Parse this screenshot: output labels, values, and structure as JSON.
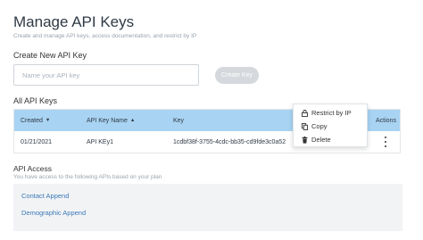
{
  "page": {
    "title": "Manage API Keys",
    "subtitle": "Create and manage API keys, access documentation, and restrict by IP"
  },
  "create": {
    "label": "Create New API Key",
    "input_placeholder": "Name your API key",
    "input_value": "",
    "button_label": "Create Key"
  },
  "keys": {
    "label": "All API Keys",
    "columns": {
      "created": "Created",
      "name": "API Key Name",
      "key": "Key",
      "actions": "Actions"
    },
    "rows": [
      {
        "created": "01/21/2021",
        "name": "API KEy1",
        "key": "1cdbf38f-3755-4cdc-bb35-cd9fde3c0a52"
      }
    ]
  },
  "actions_menu": {
    "items": [
      {
        "label": "Restrict by IP",
        "icon": "lock-icon"
      },
      {
        "label": "Copy",
        "icon": "copy-icon"
      },
      {
        "label": "Delete",
        "icon": "trash-icon"
      }
    ]
  },
  "access": {
    "label": "API Access",
    "subtitle": "You have access to the following APIs based on your plan",
    "apis": [
      {
        "label": "Contact Append"
      },
      {
        "label": "Demographic Append"
      }
    ]
  },
  "colors": {
    "table_header": "#a9d3f2",
    "link": "#3a79b8",
    "button_disabled": "#d5d8dc",
    "access_box": "#f2f3f5"
  }
}
